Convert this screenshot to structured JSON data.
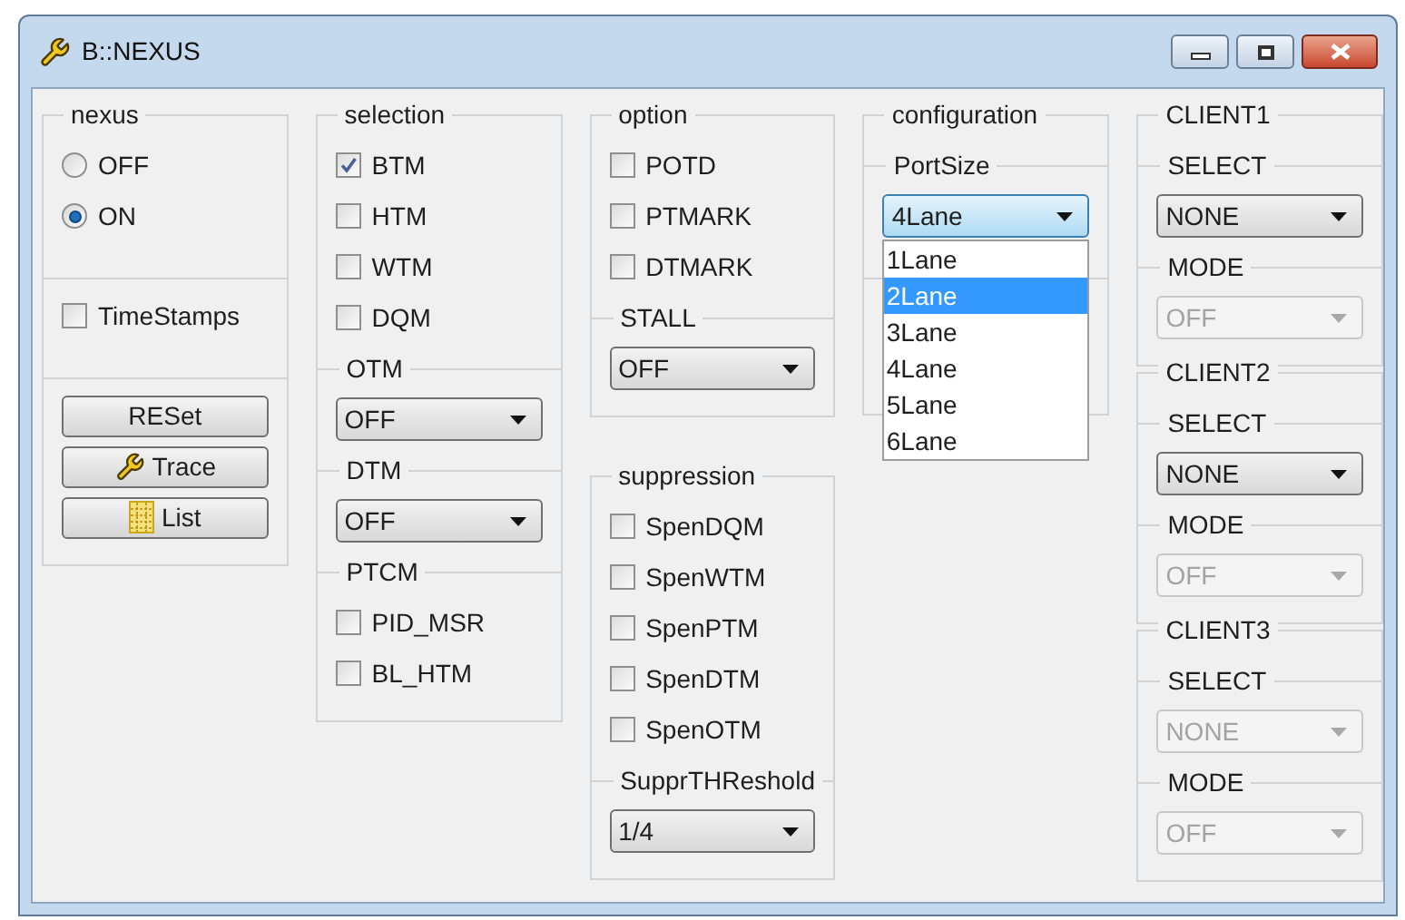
{
  "window": {
    "title": "B::NEXUS"
  },
  "columns": [
    {
      "groups": [
        {
          "title": "nexus",
          "items": [
            {
              "kind": "radio",
              "label": "OFF",
              "selected": false
            },
            {
              "kind": "radio",
              "label": "ON",
              "selected": true
            },
            {
              "kind": "separator"
            },
            {
              "kind": "checkbox",
              "label": "TimeStamps",
              "checked": false
            },
            {
              "kind": "separator"
            },
            {
              "kind": "button",
              "label": "RESet"
            },
            {
              "kind": "button",
              "label": "Trace"
            },
            {
              "kind": "button",
              "label": "List"
            }
          ]
        }
      ]
    },
    {
      "groups": [
        {
          "title": "selection",
          "items": [
            {
              "kind": "checkbox",
              "label": "BTM",
              "checked": true
            },
            {
              "kind": "checkbox",
              "label": "HTM",
              "checked": false
            },
            {
              "kind": "checkbox",
              "label": "WTM",
              "checked": false
            },
            {
              "kind": "checkbox",
              "label": "DQM",
              "checked": false
            },
            {
              "kind": "heading",
              "label": "OTM"
            },
            {
              "kind": "dropdown",
              "value": "OFF",
              "disabled": false
            },
            {
              "kind": "heading",
              "label": "DTM"
            },
            {
              "kind": "dropdown",
              "value": "OFF",
              "disabled": false
            },
            {
              "kind": "heading",
              "label": "PTCM"
            },
            {
              "kind": "checkbox",
              "label": "PID_MSR",
              "checked": false
            },
            {
              "kind": "checkbox",
              "label": "BL_HTM",
              "checked": false
            }
          ]
        }
      ]
    },
    {
      "groups": [
        {
          "title": "option",
          "items": [
            {
              "kind": "checkbox",
              "label": "POTD",
              "checked": false
            },
            {
              "kind": "checkbox",
              "label": "PTMARK",
              "checked": false
            },
            {
              "kind": "checkbox",
              "label": "DTMARK",
              "checked": false
            },
            {
              "kind": "heading",
              "label": "STALL"
            },
            {
              "kind": "dropdown",
              "value": "OFF",
              "disabled": false
            }
          ]
        },
        {
          "title": "suppression",
          "items": [
            {
              "kind": "checkbox",
              "label": "SpenDQM",
              "checked": false
            },
            {
              "kind": "checkbox",
              "label": "SpenWTM",
              "checked": false
            },
            {
              "kind": "checkbox",
              "label": "SpenPTM",
              "checked": false
            },
            {
              "kind": "checkbox",
              "label": "SpenDTM",
              "checked": false
            },
            {
              "kind": "checkbox",
              "label": "SpenOTM",
              "checked": false
            },
            {
              "kind": "heading",
              "label": "SupprTHReshold"
            },
            {
              "kind": "dropdown",
              "value": "1/4",
              "disabled": false
            }
          ]
        }
      ]
    },
    {
      "groups": [
        {
          "title": "configuration",
          "items": [
            {
              "kind": "heading",
              "label": "PortSize"
            },
            {
              "kind": "dropdown",
              "value": "4Lane",
              "disabled": false,
              "open": true,
              "options": [
                {
                  "label": "1Lane",
                  "highlighted": false
                },
                {
                  "label": "2Lane",
                  "highlighted": true
                },
                {
                  "label": "3Lane",
                  "highlighted": false
                },
                {
                  "label": "4Lane",
                  "highlighted": false
                },
                {
                  "label": "5Lane",
                  "highlighted": false
                },
                {
                  "label": "6Lane",
                  "highlighted": false
                }
              ]
            },
            {
              "kind": "separator"
            }
          ]
        }
      ]
    },
    {
      "groups": [
        {
          "title": "CLIENT1",
          "items": [
            {
              "kind": "heading",
              "label": "SELECT"
            },
            {
              "kind": "dropdown",
              "value": "NONE",
              "disabled": false
            },
            {
              "kind": "heading",
              "label": "MODE"
            },
            {
              "kind": "dropdown",
              "value": "OFF",
              "disabled": true
            }
          ]
        },
        {
          "title": "CLIENT2",
          "items": [
            {
              "kind": "heading",
              "label": "SELECT"
            },
            {
              "kind": "dropdown",
              "value": "NONE",
              "disabled": false
            },
            {
              "kind": "heading",
              "label": "MODE"
            },
            {
              "kind": "dropdown",
              "value": "OFF",
              "disabled": true
            }
          ]
        },
        {
          "title": "CLIENT3",
          "items": [
            {
              "kind": "heading",
              "label": "SELECT"
            },
            {
              "kind": "dropdown",
              "value": "NONE",
              "disabled": true
            },
            {
              "kind": "heading",
              "label": "MODE"
            },
            {
              "kind": "dropdown",
              "value": "OFF",
              "disabled": true
            }
          ]
        }
      ]
    }
  ]
}
